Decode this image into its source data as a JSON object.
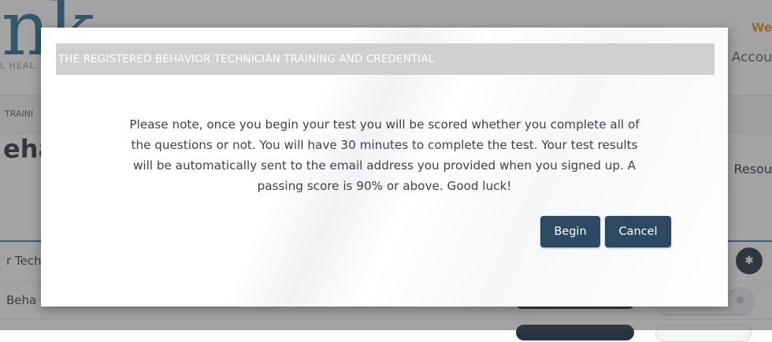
{
  "background": {
    "logo_text": "nk",
    "logo_subtext": "L HEAL",
    "welcome_text": "We",
    "account_text": "Accou",
    "breadcrumb_text": "TRAINI",
    "page_heading": "eha",
    "resources_text": "Resou",
    "rows": [
      {
        "label": "r Tech"
      },
      {
        "label": "Beha"
      }
    ]
  },
  "modal": {
    "title": "THE REGISTERED BEHAVIOR TECHNICIAN TRAINING AND CREDENTIAL",
    "body_lines": [
      "Please note, once you begin your test you will be scored whether you complete all of",
      "the questions or not. You will have 30 minutes to complete the test. Your test results",
      "will be automatically sent to the email address you provided when you signed up. A",
      "passing score is 90% or above. Good luck!"
    ],
    "begin_label": "Begin",
    "cancel_label": "Cancel"
  },
  "colors": {
    "brand_blue": "#2b6d93",
    "button_navy": "#2c4a63",
    "welcome_orange": "#e28a1f",
    "header_gray": "#cfd0d2"
  }
}
